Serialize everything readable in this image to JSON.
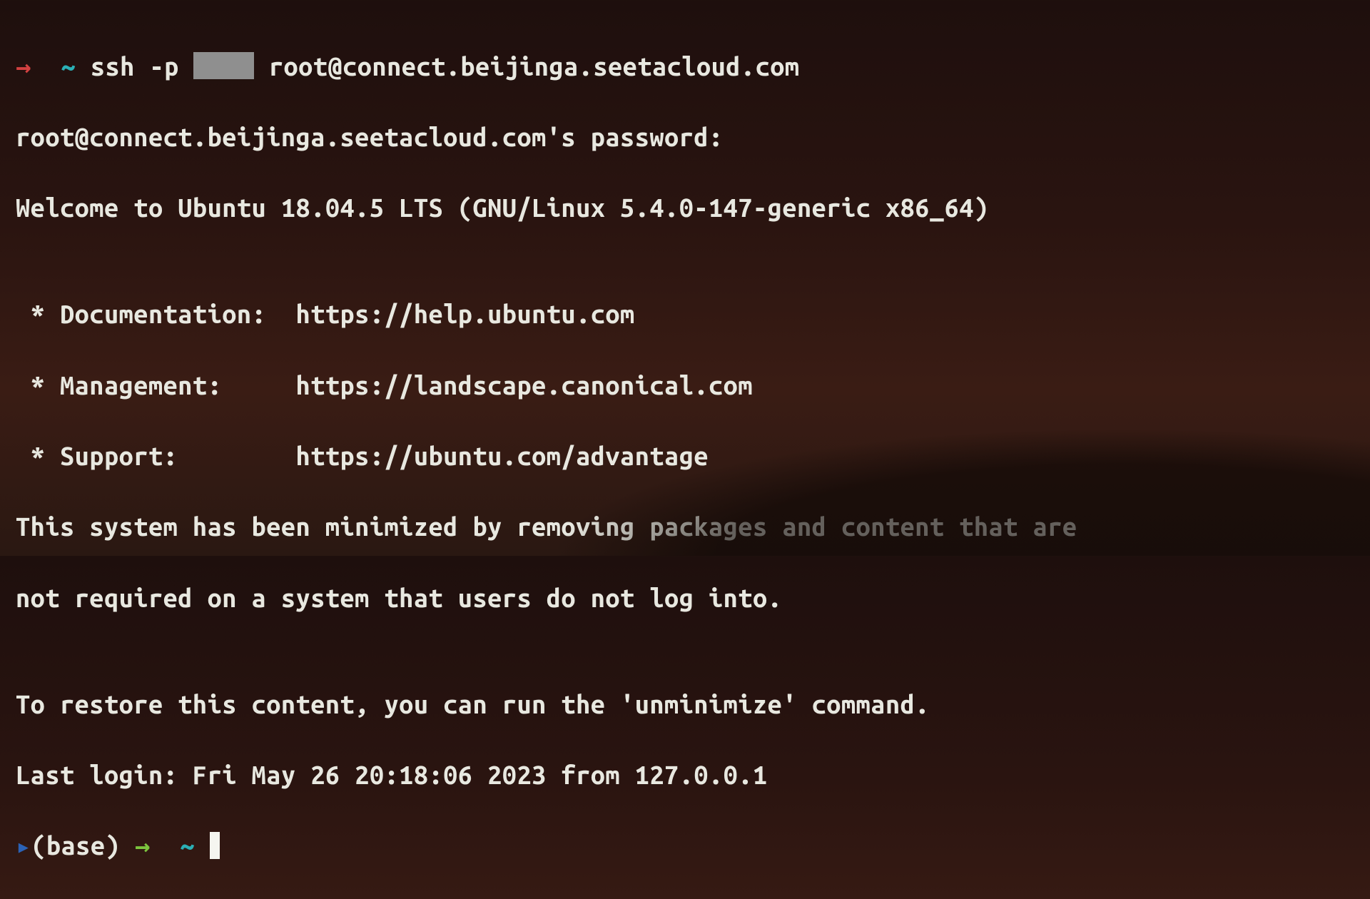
{
  "prompt1": {
    "arrow": "→",
    "tilde": "~",
    "cmd_head": "ssh -p ",
    "cmd_tail": " root@connect.beijinga.seetacloud.com"
  },
  "lines": {
    "pw": "root@connect.beijinga.seetacloud.com's password:",
    "welcome": "Welcome to Ubuntu 18.04.5 LTS (GNU/Linux 5.4.0-147-generic x86_64)",
    "blank": "",
    "doc": " * Documentation:  https://help.ubuntu.com",
    "mgmt": " * Management:     https://landscape.canonical.com",
    "supp": " * Support:        https://ubuntu.com/advantage",
    "min1": "This system has been minimized by removing packages and content that are",
    "min2": "not required on a system that users do not log into.",
    "restore": "To restore this content, you can run the 'unminimize' command.",
    "last": "Last login: Fri May 26 20:18:06 2023 from 127.0.0.1"
  },
  "prompt2": {
    "tri": "▸",
    "env": "(base)",
    "arrow": "→",
    "tilde": "~"
  }
}
